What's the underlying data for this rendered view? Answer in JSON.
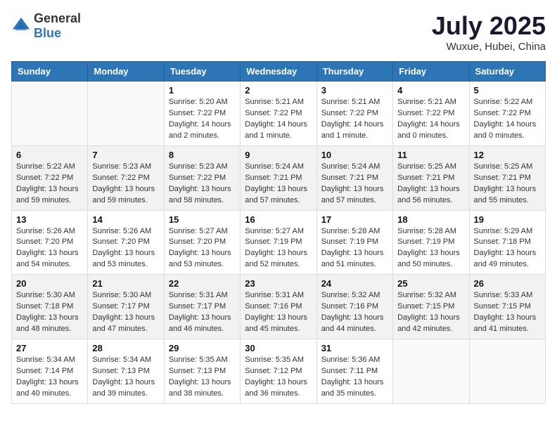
{
  "header": {
    "logo_general": "General",
    "logo_blue": "Blue",
    "month_year": "July 2025",
    "location": "Wuxue, Hubei, China"
  },
  "days_of_week": [
    "Sunday",
    "Monday",
    "Tuesday",
    "Wednesday",
    "Thursday",
    "Friday",
    "Saturday"
  ],
  "weeks": [
    [
      {
        "day": "",
        "info": ""
      },
      {
        "day": "",
        "info": ""
      },
      {
        "day": "1",
        "info": "Sunrise: 5:20 AM\nSunset: 7:22 PM\nDaylight: 14 hours and 2 minutes."
      },
      {
        "day": "2",
        "info": "Sunrise: 5:21 AM\nSunset: 7:22 PM\nDaylight: 14 hours and 1 minute."
      },
      {
        "day": "3",
        "info": "Sunrise: 5:21 AM\nSunset: 7:22 PM\nDaylight: 14 hours and 1 minute."
      },
      {
        "day": "4",
        "info": "Sunrise: 5:21 AM\nSunset: 7:22 PM\nDaylight: 14 hours and 0 minutes."
      },
      {
        "day": "5",
        "info": "Sunrise: 5:22 AM\nSunset: 7:22 PM\nDaylight: 14 hours and 0 minutes."
      }
    ],
    [
      {
        "day": "6",
        "info": "Sunrise: 5:22 AM\nSunset: 7:22 PM\nDaylight: 13 hours and 59 minutes."
      },
      {
        "day": "7",
        "info": "Sunrise: 5:23 AM\nSunset: 7:22 PM\nDaylight: 13 hours and 59 minutes."
      },
      {
        "day": "8",
        "info": "Sunrise: 5:23 AM\nSunset: 7:22 PM\nDaylight: 13 hours and 58 minutes."
      },
      {
        "day": "9",
        "info": "Sunrise: 5:24 AM\nSunset: 7:21 PM\nDaylight: 13 hours and 57 minutes."
      },
      {
        "day": "10",
        "info": "Sunrise: 5:24 AM\nSunset: 7:21 PM\nDaylight: 13 hours and 57 minutes."
      },
      {
        "day": "11",
        "info": "Sunrise: 5:25 AM\nSunset: 7:21 PM\nDaylight: 13 hours and 56 minutes."
      },
      {
        "day": "12",
        "info": "Sunrise: 5:25 AM\nSunset: 7:21 PM\nDaylight: 13 hours and 55 minutes."
      }
    ],
    [
      {
        "day": "13",
        "info": "Sunrise: 5:26 AM\nSunset: 7:20 PM\nDaylight: 13 hours and 54 minutes."
      },
      {
        "day": "14",
        "info": "Sunrise: 5:26 AM\nSunset: 7:20 PM\nDaylight: 13 hours and 53 minutes."
      },
      {
        "day": "15",
        "info": "Sunrise: 5:27 AM\nSunset: 7:20 PM\nDaylight: 13 hours and 53 minutes."
      },
      {
        "day": "16",
        "info": "Sunrise: 5:27 AM\nSunset: 7:19 PM\nDaylight: 13 hours and 52 minutes."
      },
      {
        "day": "17",
        "info": "Sunrise: 5:28 AM\nSunset: 7:19 PM\nDaylight: 13 hours and 51 minutes."
      },
      {
        "day": "18",
        "info": "Sunrise: 5:28 AM\nSunset: 7:19 PM\nDaylight: 13 hours and 50 minutes."
      },
      {
        "day": "19",
        "info": "Sunrise: 5:29 AM\nSunset: 7:18 PM\nDaylight: 13 hours and 49 minutes."
      }
    ],
    [
      {
        "day": "20",
        "info": "Sunrise: 5:30 AM\nSunset: 7:18 PM\nDaylight: 13 hours and 48 minutes."
      },
      {
        "day": "21",
        "info": "Sunrise: 5:30 AM\nSunset: 7:17 PM\nDaylight: 13 hours and 47 minutes."
      },
      {
        "day": "22",
        "info": "Sunrise: 5:31 AM\nSunset: 7:17 PM\nDaylight: 13 hours and 46 minutes."
      },
      {
        "day": "23",
        "info": "Sunrise: 5:31 AM\nSunset: 7:16 PM\nDaylight: 13 hours and 45 minutes."
      },
      {
        "day": "24",
        "info": "Sunrise: 5:32 AM\nSunset: 7:16 PM\nDaylight: 13 hours and 44 minutes."
      },
      {
        "day": "25",
        "info": "Sunrise: 5:32 AM\nSunset: 7:15 PM\nDaylight: 13 hours and 42 minutes."
      },
      {
        "day": "26",
        "info": "Sunrise: 5:33 AM\nSunset: 7:15 PM\nDaylight: 13 hours and 41 minutes."
      }
    ],
    [
      {
        "day": "27",
        "info": "Sunrise: 5:34 AM\nSunset: 7:14 PM\nDaylight: 13 hours and 40 minutes."
      },
      {
        "day": "28",
        "info": "Sunrise: 5:34 AM\nSunset: 7:13 PM\nDaylight: 13 hours and 39 minutes."
      },
      {
        "day": "29",
        "info": "Sunrise: 5:35 AM\nSunset: 7:13 PM\nDaylight: 13 hours and 38 minutes."
      },
      {
        "day": "30",
        "info": "Sunrise: 5:35 AM\nSunset: 7:12 PM\nDaylight: 13 hours and 36 minutes."
      },
      {
        "day": "31",
        "info": "Sunrise: 5:36 AM\nSunset: 7:11 PM\nDaylight: 13 hours and 35 minutes."
      },
      {
        "day": "",
        "info": ""
      },
      {
        "day": "",
        "info": ""
      }
    ]
  ]
}
